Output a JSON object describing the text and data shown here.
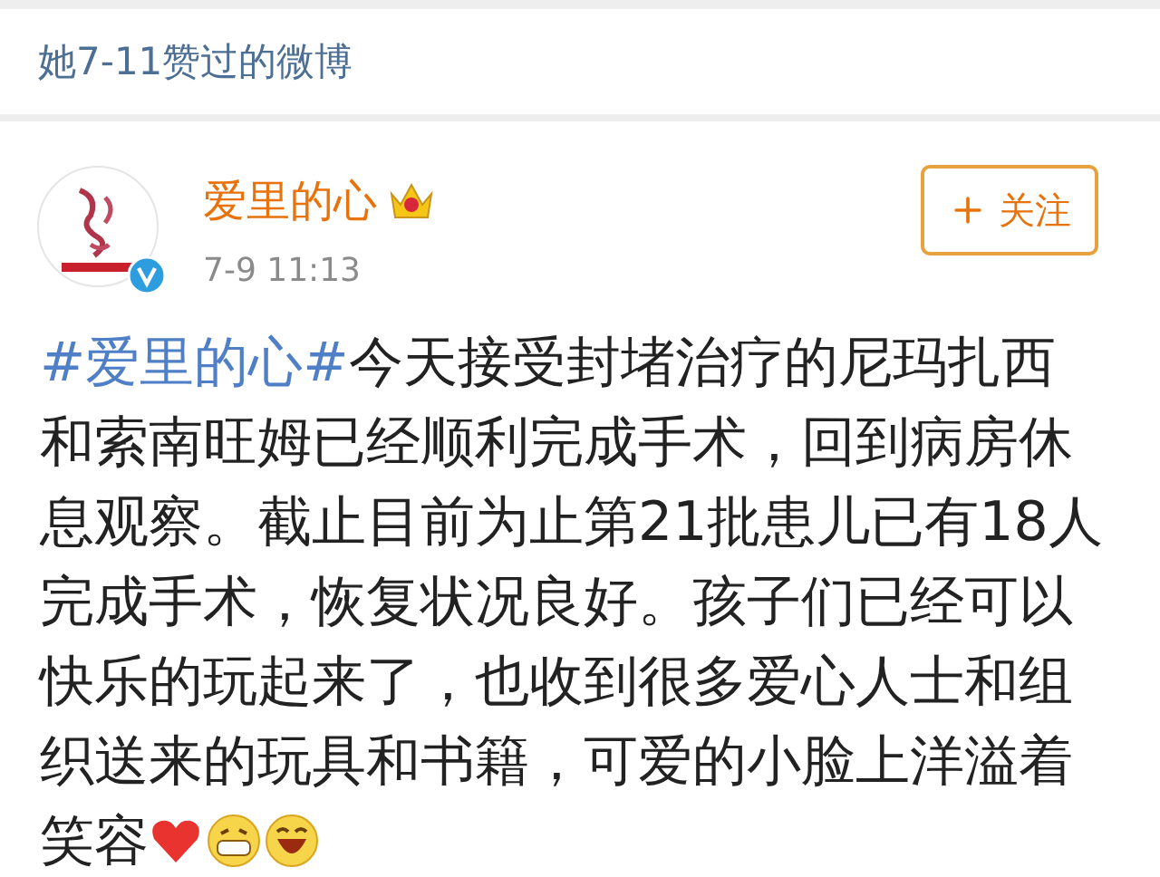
{
  "header": {
    "title": "她7-11赞过的微博"
  },
  "post": {
    "author": "爱里的心",
    "time": "7-9 11:13",
    "follow_button": "关注",
    "hashtag": "#爱里的心#",
    "text": "今天接受封堵治疗的尼玛扎西和索南旺姆已经顺利完成手术，回到病房休息观察。截止目前为止第21批患儿已有18人完成手术，恢复状况良好。孩子们已经可以快乐的玩起来了，也收到很多爱心人士和组织送来的玩具和书籍，可爱的小脸上洋溢着笑容"
  }
}
